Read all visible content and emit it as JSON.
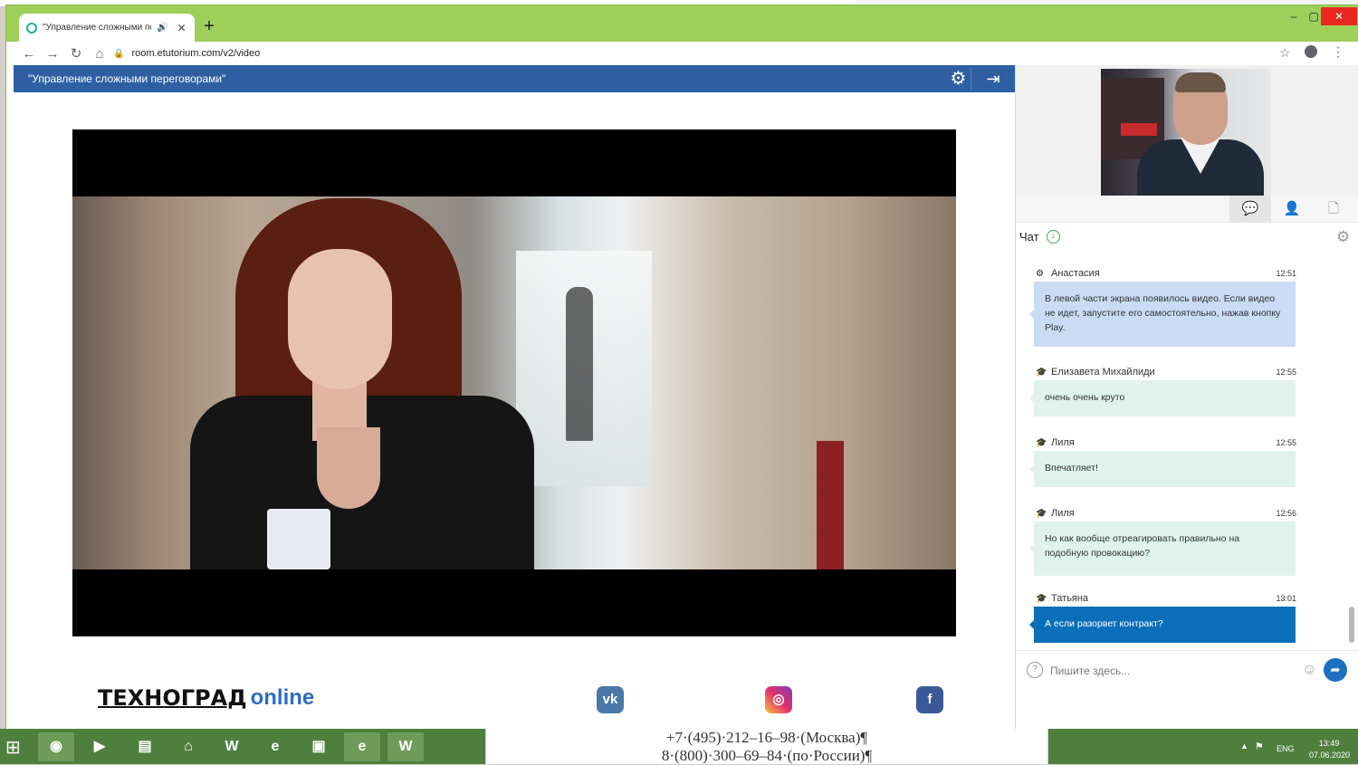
{
  "browser": {
    "tab_title": "\"Управление сложными пе",
    "url": "room.etutorium.com/v2/video",
    "window_controls": [
      "–",
      "▢",
      "✕"
    ]
  },
  "webinar": {
    "title": "\"Управление сложными переговорами\""
  },
  "footer": {
    "logo_part1": "ТЕХНОГРАД",
    "logo_part2": "online",
    "social": [
      "vk",
      "instagram",
      "facebook"
    ]
  },
  "chat": {
    "title": "Чат",
    "input_placeholder": "Пишите здесь...",
    "messages": [
      {
        "author": "Анастасия",
        "role_icon": "gear-icon",
        "time": "12:51",
        "text": "В левой части экрана появилось видео. Если видео не идет, запустите его самостоятельно, нажав кнопку Play.",
        "style": "blue"
      },
      {
        "author": "Елизавета Михайлиди",
        "role_icon": "graduation-cap-icon",
        "time": "12:55",
        "text": "очень очень круто",
        "style": "green"
      },
      {
        "author": "Лиля",
        "role_icon": "graduation-cap-icon",
        "time": "12:55",
        "text": "Впечатляет!",
        "style": "green"
      },
      {
        "author": "Лиля",
        "role_icon": "graduation-cap-icon",
        "time": "12:56",
        "text": "Но как вообще отреагировать правильно на подобную провокацию?",
        "style": "green"
      },
      {
        "author": "Татьяна",
        "role_icon": "graduation-cap-icon",
        "time": "13:01",
        "text": "А если разорвет контракт?",
        "style": "dark"
      }
    ]
  },
  "word_doc": {
    "line1": "+7·(495)·212–16–98·(Москва)¶",
    "line2": "8·(800)·300–69–84·(по·России)¶"
  },
  "taskbar": {
    "lang": "ENG",
    "time": "13:49",
    "date": "07.06.2020"
  },
  "colors": {
    "header_blue": "#2f5fa3",
    "browser_frame": "#9ecf5a",
    "bubble_blue": "#c9dcf4",
    "bubble_green": "#dff3ec",
    "bubble_dark": "#0a6fb8"
  }
}
